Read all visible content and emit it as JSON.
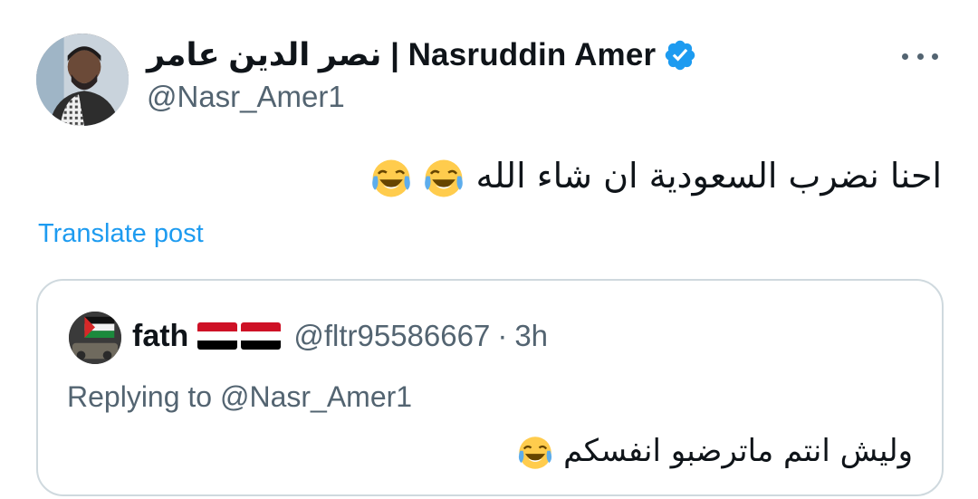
{
  "author": {
    "display_name": "نصر الدين عامر | Nasruddin Amer",
    "handle": "@Nasr_Amer1",
    "verified": true
  },
  "post": {
    "text": "احنا نضرب السعودية ان شاء الله",
    "emojis": [
      "face-with-tears-of-joy",
      "face-with-tears-of-joy"
    ],
    "translate_label": "Translate post"
  },
  "quoted": {
    "name": "fath",
    "flags": [
      "yemen-flag",
      "yemen-flag"
    ],
    "handle": "@fltr95586667",
    "separator": "·",
    "time": "3h",
    "replying_to": "Replying to @Nasr_Amer1",
    "text": "وليش انتم ماترضبو انفسكم",
    "emojis": [
      "face-with-tears-of-joy"
    ]
  },
  "colors": {
    "link": "#1d9bf0",
    "secondary_text": "#536471",
    "border": "#cfd9de",
    "verified": "#1d9bf0"
  }
}
